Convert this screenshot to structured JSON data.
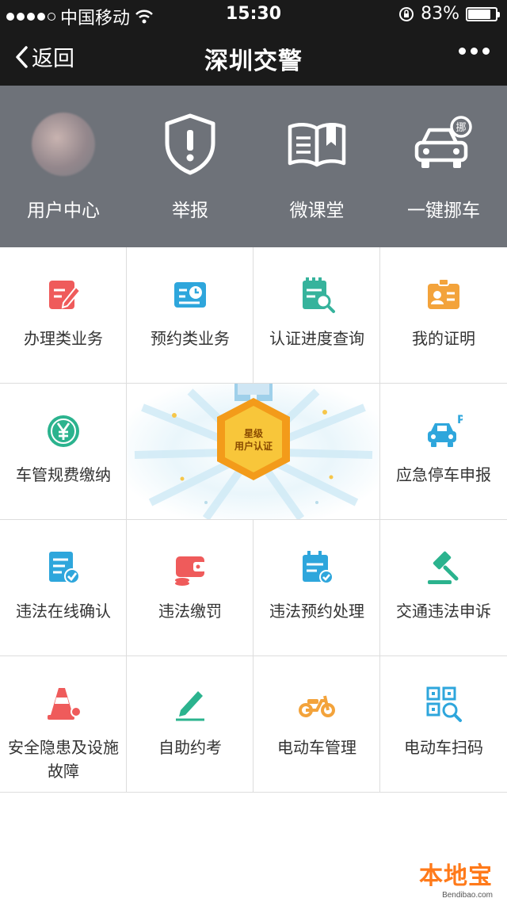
{
  "status_bar": {
    "carrier": "中国移动",
    "time": "15:30",
    "battery": "83%",
    "battery_level": 0.83
  },
  "nav": {
    "back_label": "返回",
    "title": "深圳交警"
  },
  "quick": [
    {
      "label": "用户中心",
      "icon": "avatar"
    },
    {
      "label": "举报",
      "icon": "shield-alert-icon"
    },
    {
      "label": "微课堂",
      "icon": "book-icon"
    },
    {
      "label": "一键挪车",
      "icon": "car-move-icon"
    }
  ],
  "grid": {
    "items": [
      {
        "label": "办理类业务",
        "icon": "edit-doc-icon",
        "color": "#ef5b5b"
      },
      {
        "label": "预约类业务",
        "icon": "clock-card-icon",
        "color": "#2ea6dc"
      },
      {
        "label": "认证进度查询",
        "icon": "doc-search-icon",
        "color": "#36b39c"
      },
      {
        "label": "我的证明",
        "icon": "id-badge-icon",
        "color": "#f3a33b"
      },
      {
        "label": "车管规费缴纳",
        "icon": "yuan-coin-icon",
        "color": "#2bb38e"
      },
      {
        "label": "应急停车申报",
        "icon": "car-parking-icon",
        "color": "#2ea6dc"
      },
      {
        "label": "违法在线确认",
        "icon": "doc-check-icon",
        "color": "#2ea6dc"
      },
      {
        "label": "违法缴罚",
        "icon": "wallet-icon",
        "color": "#ef5b5b"
      },
      {
        "label": "违法预约处理",
        "icon": "calendar-check-icon",
        "color": "#2ea6dc"
      },
      {
        "label": "交通违法申诉",
        "icon": "gavel-icon",
        "color": "#2bb38e"
      },
      {
        "label": "安全隐患及设施故障",
        "icon": "traffic-cone-icon",
        "color": "#ef5b5b"
      },
      {
        "label": "自助约考",
        "icon": "pen-icon",
        "color": "#2bb38e"
      },
      {
        "label": "电动车管理",
        "icon": "scooter-icon",
        "color": "#f3a33b"
      },
      {
        "label": "电动车扫码",
        "icon": "qr-scan-icon",
        "color": "#2ea6dc"
      }
    ],
    "banner": {
      "line1": "星级",
      "line2": "用户认证"
    }
  },
  "watermark": {
    "brand": "本地宝",
    "site": "Bendibao.com"
  }
}
